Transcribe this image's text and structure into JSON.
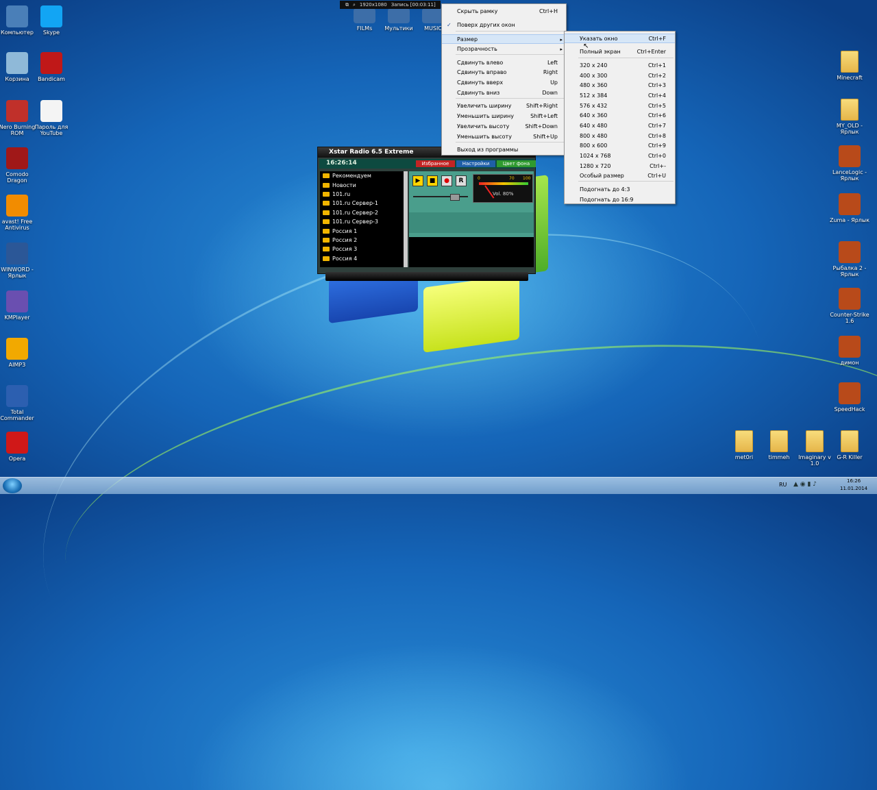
{
  "desktop_left": [
    {
      "label": "Компьютер",
      "icon": "computer-icon",
      "color": "#4a7fb8"
    },
    {
      "label": "Skype",
      "icon": "skype-icon",
      "color": "#12a5f4"
    },
    {
      "label": "Корзина",
      "icon": "recycle-bin-icon",
      "color": "#8fb9d8"
    },
    {
      "label": "Bandicam",
      "icon": "bandicam-icon",
      "color": "#c01818"
    },
    {
      "label": "Nero Burning ROM",
      "icon": "nero-icon",
      "color": "#c0302a"
    },
    {
      "label": "Пароль для YouTube",
      "icon": "text-file-icon",
      "color": "#f4f4f4"
    },
    {
      "label": "Comodo Dragon",
      "icon": "comodo-dragon-icon",
      "color": "#a01818"
    },
    {
      "label": "avast! Free Antivirus",
      "icon": "avast-icon",
      "color": "#f28c00"
    },
    {
      "label": "WINWORD - Ярлык",
      "icon": "word-icon",
      "color": "#2b5797"
    },
    {
      "label": "KMPlayer",
      "icon": "kmplayer-icon",
      "color": "#6a4fb0"
    },
    {
      "label": "AIMP3",
      "icon": "aimp-icon",
      "color": "#f2a900"
    },
    {
      "label": "Total Commander",
      "icon": "total-commander-icon",
      "color": "#2c5fb0"
    },
    {
      "label": "Opera",
      "icon": "opera-icon",
      "color": "#d01818"
    }
  ],
  "desktop_right": [
    {
      "label": "Minecraft",
      "icon": "folder-icon"
    },
    {
      "label": "MY_OLD - Ярлык",
      "icon": "folder-icon"
    },
    {
      "label": "LanceLogic - Ярлык",
      "icon": "lancelogic-icon"
    },
    {
      "label": "Zuma - Ярлык",
      "icon": "zuma-icon"
    },
    {
      "label": "Рыбалка 2 - Ярлык",
      "icon": "fishing-icon"
    },
    {
      "label": "Counter-Strike 1.6",
      "icon": "counter-strike-icon"
    },
    {
      "label": "димон",
      "icon": "cs-gear-icon"
    },
    {
      "label": "SpeedHack",
      "icon": "speedhack-icon"
    }
  ],
  "desktop_bottom": [
    {
      "label": "met0ri"
    },
    {
      "label": "timmeh"
    },
    {
      "label": "Imaginary v 1.0"
    },
    {
      "label": "G-R Killer"
    }
  ],
  "desktop_top": [
    {
      "label": "FILMs"
    },
    {
      "label": "Мультики"
    },
    {
      "label": "MUSIC"
    }
  ],
  "recorder": {
    "resolution": "1920x1080",
    "status": "Запись [00:03:11]"
  },
  "xstar": {
    "title": "Xstar Radio 6.5 Extreme",
    "time": "16:26:14",
    "tabs": [
      "Избранное",
      "Настройки",
      "Цвет фона"
    ],
    "stations": [
      "Рекомендуем",
      "Новости",
      "101.ru",
      "101.ru Сервер-1",
      "101.ru Сервер-2",
      "101.ru Сервер-3",
      "Россия 1",
      "Россия 2",
      "Россия 3",
      "Россия 4"
    ],
    "buttons": [
      "▶",
      "■",
      "●",
      "R"
    ],
    "meter": {
      "min": "0",
      "mid": "70",
      "max": "100"
    },
    "volume": "Vol. 80%",
    "volume_level": 0.8
  },
  "menu": {
    "items": [
      {
        "label": "Скрыть рамку",
        "shortcut": "Ctrl+H"
      },
      {
        "label": "Поверх других окон",
        "shortcut": "",
        "checked": "✓"
      },
      {
        "label": "Размер",
        "shortcut": ""
      },
      {
        "label": "Прозрачность",
        "shortcut": ""
      },
      {
        "label": "Сдвинуть влево",
        "shortcut": "Left"
      },
      {
        "label": "Сдвинуть вправо",
        "shortcut": "Right"
      },
      {
        "label": "Сдвинуть вверх",
        "shortcut": "Up"
      },
      {
        "label": "Сдвинуть вниз",
        "shortcut": "Down"
      },
      {
        "label": "Увеличить ширину",
        "shortcut": "Shift+Right"
      },
      {
        "label": "Уменьшить ширину",
        "shortcut": "Shift+Left"
      },
      {
        "label": "Увеличить высоту",
        "shortcut": "Shift+Down"
      },
      {
        "label": "Уменьшить высоту",
        "shortcut": "Shift+Up"
      },
      {
        "label": "Выход из программы",
        "shortcut": ""
      }
    ]
  },
  "submenu": {
    "items": [
      {
        "label": "Указать окно",
        "shortcut": "Ctrl+F"
      },
      {
        "label": "Полный экран",
        "shortcut": "Ctrl+Enter"
      },
      {
        "label": "320 x 240",
        "shortcut": "Ctrl+1"
      },
      {
        "label": "400 x 300",
        "shortcut": "Ctrl+2"
      },
      {
        "label": "480 x 360",
        "shortcut": "Ctrl+3"
      },
      {
        "label": "512 x 384",
        "shortcut": "Ctrl+4"
      },
      {
        "label": "576 x 432",
        "shortcut": "Ctrl+5"
      },
      {
        "label": "640 x 360",
        "shortcut": "Ctrl+6"
      },
      {
        "label": "640 x 480",
        "shortcut": "Ctrl+7"
      },
      {
        "label": "800 x 480",
        "shortcut": "Ctrl+8"
      },
      {
        "label": "800 x 600",
        "shortcut": "Ctrl+9"
      },
      {
        "label": "1024 x 768",
        "shortcut": "Ctrl+0"
      },
      {
        "label": "1280 x 720",
        "shortcut": "Ctrl+-"
      },
      {
        "label": "Особый размер",
        "shortcut": "Ctrl+U"
      },
      {
        "label": "Подогнать до 4:3",
        "shortcut": ""
      },
      {
        "label": "Подогнать до 16:9",
        "shortcut": ""
      }
    ]
  },
  "taskbar": {
    "lang": "RU",
    "time": "16:26",
    "date": "11.01.2014"
  }
}
